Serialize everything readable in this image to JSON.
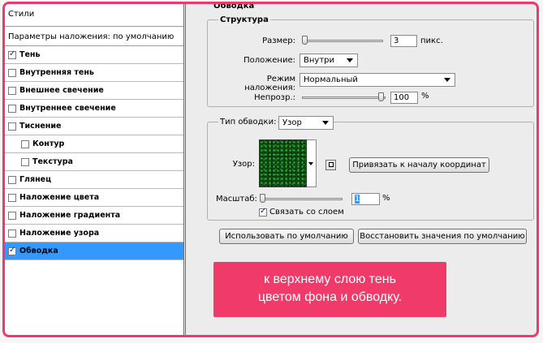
{
  "left_panel": {
    "title": "Стили",
    "subtitle": "Параметры наложения: по умолчанию",
    "items": [
      {
        "label": "Тень",
        "checked": true
      },
      {
        "label": "Внутренняя тень",
        "checked": false
      },
      {
        "label": "Внешнее свечение",
        "checked": false
      },
      {
        "label": "Внутреннее свечение",
        "checked": false
      },
      {
        "label": "Тиснение",
        "checked": false
      },
      {
        "label": "Контур",
        "checked": false
      },
      {
        "label": "Текстура",
        "checked": false
      },
      {
        "label": "Глянец",
        "checked": false
      },
      {
        "label": "Наложение цвета",
        "checked": false
      },
      {
        "label": "Наложение градиента",
        "checked": false
      },
      {
        "label": "Наложение узора",
        "checked": false
      },
      {
        "label": "Обводка",
        "checked": true,
        "selected": true
      }
    ]
  },
  "stroke": {
    "section_title": "Обводка",
    "structure": {
      "legend": "Структура",
      "size_label": "Размер:",
      "size_value": "3",
      "size_unit": "пикс.",
      "position_label": "Положение:",
      "position_value": "Внутри",
      "blend_label": "Режим наложения:",
      "blend_value": "Нормальный",
      "opacity_label": "Непрозр.:",
      "opacity_value": "100",
      "opacity_unit": "%"
    },
    "fill": {
      "type_label": "Тип обводки:",
      "type_value": "Узор",
      "pattern_label": "Узор:",
      "snap_button": "Привязать к началу координат",
      "scale_label": "Масштаб:",
      "scale_value": "1",
      "scale_unit": "%",
      "link_label": "Связать со слоем",
      "link_checked": true
    },
    "buttons": {
      "default": "Использовать по умолчанию",
      "restore": "Восстановить значения по умолчанию"
    }
  },
  "overlay": {
    "line1": "к верхнему слою тень",
    "line2": "цветом фона и обводку."
  },
  "colors": {
    "frame": "#f0386b",
    "selected": "#3399ff",
    "overlay": "#f03a6a"
  }
}
